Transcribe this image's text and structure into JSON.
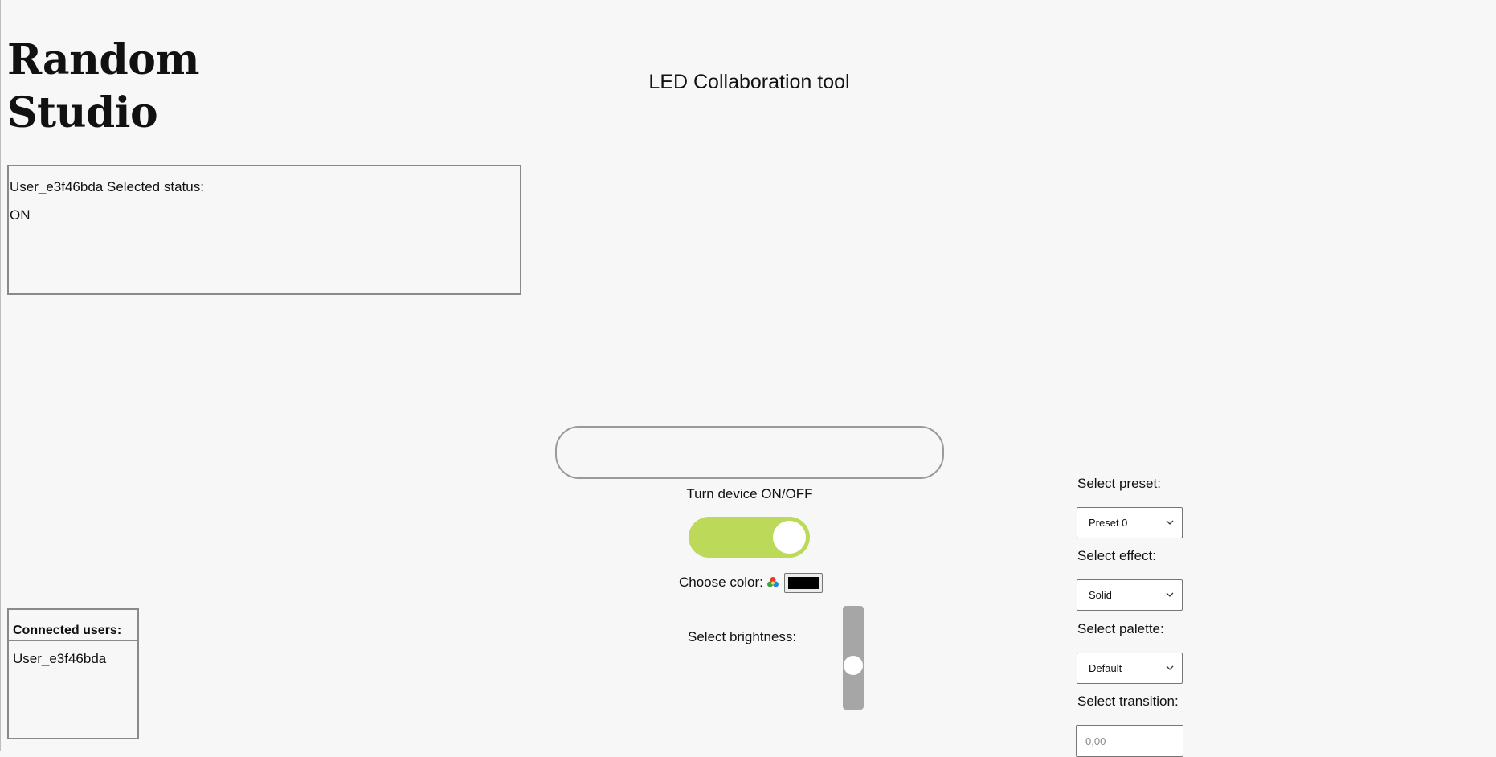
{
  "brand": {
    "line1": "Random",
    "line2": "Studio"
  },
  "page_title": "LED Collaboration tool",
  "status_panel": {
    "heading": "User_e3f46bda Selected status:",
    "value": "ON"
  },
  "connected_users": {
    "heading": "Connected users:",
    "users": [
      "User_e3f46bda"
    ]
  },
  "device": {
    "onoff_label": "Turn device ON/OFF",
    "power_on": true,
    "color_label": "Choose color:",
    "color_value": "#000000",
    "brightness_label": "Select brightness:",
    "brightness_fraction": 0.41
  },
  "controls": {
    "preset_label": "Select preset:",
    "preset_value": "Preset 0",
    "effect_label": "Select effect:",
    "effect_value": "Solid",
    "palette_label": "Select palette:",
    "palette_value": "Default",
    "transition_label": "Select transition:",
    "transition_placeholder": "0,00"
  },
  "colors": {
    "toggle_on": "#bcd95a",
    "slider_track": "#a6a6a6",
    "border": "#8a8a8a"
  }
}
